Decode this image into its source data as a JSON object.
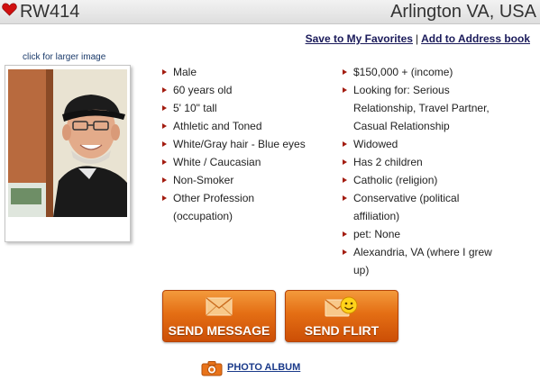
{
  "profile": {
    "username": "RW414",
    "location": "Arlington VA, USA"
  },
  "actions": {
    "save_favorites": "Save to My Favorites",
    "separator": "|",
    "add_address_book": "Add to Address book"
  },
  "photo": {
    "caption": "click for larger image"
  },
  "details_left": [
    "Male",
    "60 years old",
    "5' 10\" tall",
    "Athletic and Toned",
    "White/Gray hair - Blue eyes",
    "White / Caucasian",
    "Non-Smoker",
    "Other Profession (occupation)"
  ],
  "details_right": [
    "$150,000 + (income)",
    "Looking for: Serious Relationship, Travel Partner, Casual Relationship",
    "Widowed",
    "Has 2 children",
    "Catholic (religion)",
    "Conservative (political affiliation)",
    "pet: None",
    "Alexandria, VA (where I grew up)"
  ],
  "buttons": {
    "send_message": "SEND MESSAGE",
    "send_flirt": "SEND FLIRT"
  },
  "album": {
    "label": "PHOTO ALBUM"
  },
  "icons": {
    "heart": "heart-icon",
    "bullet": "bullet-arrow-icon",
    "message": "envelope-icon",
    "flirt": "envelope-smiley-icon",
    "album": "camera-icon"
  },
  "colors": {
    "accent_orange": "#e46e14",
    "bullet_red": "#a31c10",
    "link_blue": "#1a3a8a",
    "heart_red": "#d01010"
  }
}
